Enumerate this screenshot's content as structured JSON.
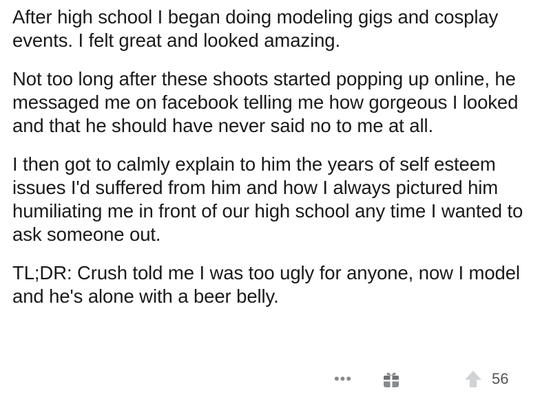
{
  "post": {
    "paragraphs": [
      "After high school I began doing modeling gigs and cosplay events. I felt great and looked amazing.",
      "Not too long after these shoots started popping up online, he messaged me on facebook telling me how gorgeous I looked and that he should have never said no to me at all.",
      "I then got to calmly explain to him the years of self esteem issues I'd suffered from him and how I always pictured him humiliating me in front of our high school any time I wanted to ask someone out.",
      "TL;DR: Crush told me I was too ugly for anyone, now I model and he's alone with a beer belly."
    ]
  },
  "actions": {
    "more_label": "•••",
    "gift_icon": "gift-icon",
    "upvote_icon": "upvote-arrow-icon",
    "score": "56"
  },
  "colors": {
    "text": "#1a1a1b",
    "icon_gray": "#878a8c"
  }
}
